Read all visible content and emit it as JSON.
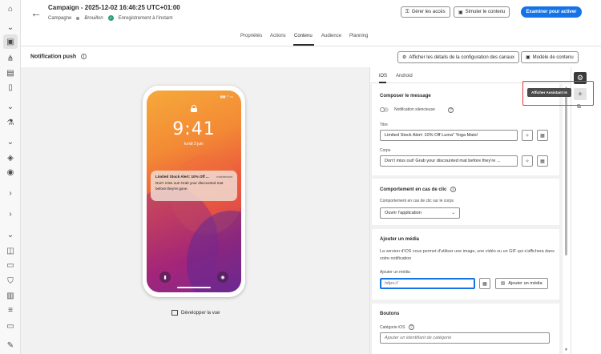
{
  "header": {
    "title": "Campaign - 2025-12-02 16:46:25 UTC+01:00",
    "breadcrumb": "Campagne",
    "status": "Brouillon",
    "save_status": "Enregistrement à l'instant",
    "manage_access_label": "Gérer les accès",
    "simulate_label": "Simuler le contenu",
    "review_label": "Examiner pour activer"
  },
  "tabs": [
    "Propriétés",
    "Actions",
    "Contenu",
    "Audience",
    "Planning"
  ],
  "active_tab": "Contenu",
  "subheader": {
    "title": "Notification push",
    "config_details_label": "Afficher les détails de la configuration des canaux",
    "template_label": "Modèle de contenu"
  },
  "preview": {
    "time": "9:41",
    "date": "lundi 3 juin",
    "notification": {
      "title": "Limited Stock Alert: 10% Off ...",
      "when": "maintenant",
      "body": "Don't miss out! Grab your discounted mat before they're gone."
    },
    "expand_label": "Développer la vue"
  },
  "panel": {
    "tabs": [
      "iOS",
      "Android"
    ],
    "active_tab": "iOS",
    "compose": {
      "title": "Composer le message",
      "silent_label": "Notification silencieuse",
      "title_label": "Titre",
      "title_value": "Limited Stock Alert: 10% Off Luma\" Yoga Mats!",
      "body_label": "Corps",
      "body_value": "Don't miss out! Grab your discounted mat before they're ..."
    },
    "click": {
      "title": "Comportement en cas de clic",
      "body_label": "Comportement en cas de clic sur le corps",
      "body_value": "Ouvrir l'application"
    },
    "media": {
      "title": "Ajouter un média",
      "description": "La version d'iOS vous permet d'utiliser une image, une vidéo ou un GIF qui s'affichera dans votre notification",
      "field_label": "Ajouter un média",
      "field_value": "https://",
      "add_button": "Ajouter un média"
    },
    "buttons": {
      "title": "Boutons",
      "category_label": "Catégorie iOS",
      "category_placeholder": "Ajouter un identifiant de catégorie"
    }
  },
  "side": {
    "tooltip": "Afficher Assistant IA"
  },
  "icons": {
    "rail": [
      "home-icon",
      "chevron-down-icon",
      "channel-icon",
      "journey-icon",
      "content-icon",
      "document-icon",
      "chevron-down-icon",
      "flask-icon",
      "chevron-down-icon",
      "decision-icon",
      "offer-icon",
      "chevron-right-icon",
      "chevron-right-icon",
      "chevron-down-icon",
      "segment-icon",
      "id-card-icon",
      "shield-icon",
      "dashboard-icon",
      "list-icon",
      "folder-icon",
      "edit-icon"
    ]
  },
  "colors": {
    "accent": "#1473e6",
    "highlight_box": "#e23a3a",
    "success": "#2d9d78"
  }
}
